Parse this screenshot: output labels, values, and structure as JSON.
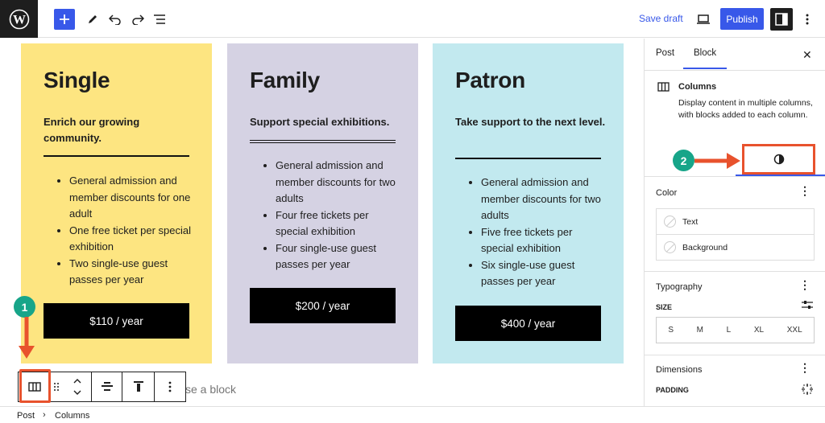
{
  "toolbar": {
    "save_draft_label": "Save draft",
    "publish_label": "Publish",
    "icons": [
      "wordpress-logo-icon",
      "plus-icon",
      "pencil-icon",
      "undo-icon",
      "redo-icon",
      "list-view-icon",
      "desktop-preview-icon",
      "settings-panel-icon",
      "more-options-icon"
    ]
  },
  "cards": [
    {
      "title": "Single",
      "tagline": "Enrich our growing community.",
      "features": [
        "General admission and member discounts for one adult",
        "One free ticket per special exhibition",
        "Two single-use guest passes per year"
      ],
      "price": "$110 / year",
      "color": "#fde581"
    },
    {
      "title": "Family",
      "tagline": "Support special exhibitions.",
      "features": [
        "General admission and member discounts for two adults",
        "Four free tickets per special exhibition",
        "Four single-use guest passes per year"
      ],
      "price": "$200 / year",
      "color": "#d5d2e3"
    },
    {
      "title": "Patron",
      "tagline": "Take support to the next level.",
      "features": [
        "General admission and member discounts for two adults",
        "Five free tickets per special exhibition",
        "Six single-use guest passes per year"
      ],
      "price": "$400 / year",
      "color": "#c2e9ef"
    }
  ],
  "editor": {
    "add_block_hint": "se a block"
  },
  "annotations": {
    "step1": "1",
    "step2": "2",
    "color": "#e8522d"
  },
  "sidebar": {
    "tabs": {
      "post": "Post",
      "block": "Block"
    },
    "block_name": "Columns",
    "block_description": "Display content in multiple columns, with blocks added to each column.",
    "color_panel": {
      "title": "Color",
      "text_label": "Text",
      "background_label": "Background"
    },
    "typography_panel": {
      "title": "Typography",
      "size_label": "SIZE",
      "sizes": [
        "S",
        "M",
        "L",
        "XL",
        "XXL"
      ]
    },
    "dimensions_panel": {
      "title": "Dimensions",
      "padding_label": "PADDING"
    }
  },
  "breadcrumb": {
    "items": [
      "Post",
      "Columns"
    ]
  },
  "accent_color": "#3858e9"
}
